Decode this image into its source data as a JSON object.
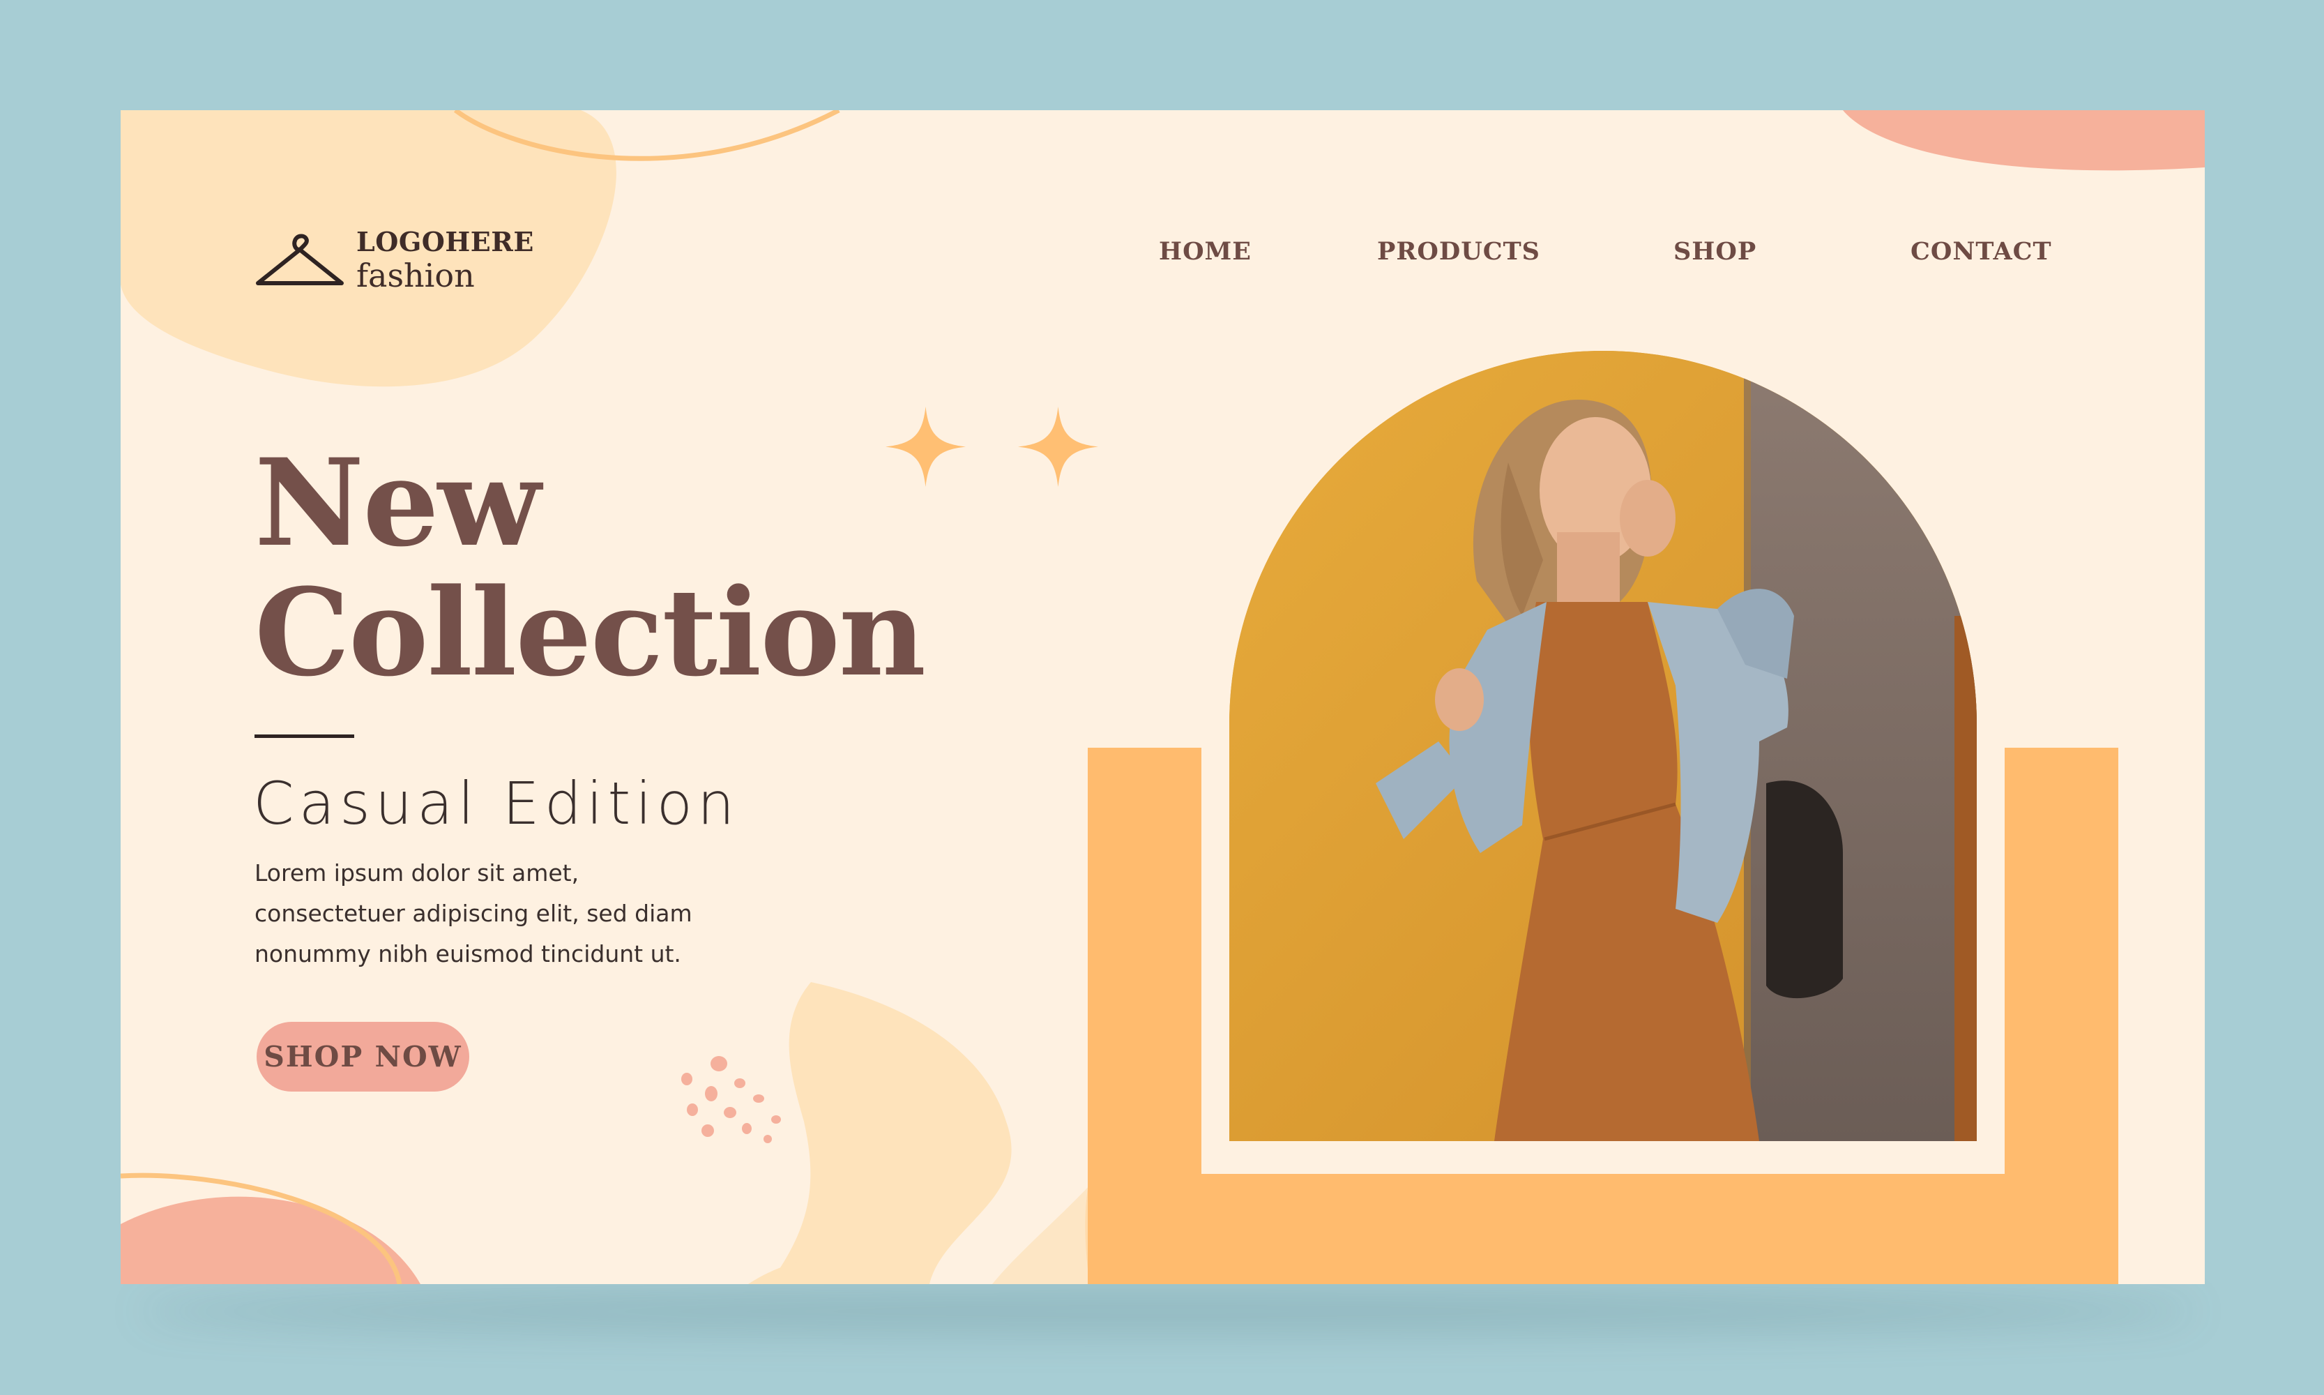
{
  "brand": {
    "logo_top": "LOGOHERE",
    "logo_bottom": "fashion",
    "icon": "hanger-icon"
  },
  "nav": {
    "home": "HOME",
    "products": "PRODUCTS",
    "shop": "SHOP",
    "contact": "CONTACT"
  },
  "hero": {
    "title_line1": "New",
    "title_line2": "Collection",
    "subtitle": "Casual Edition",
    "desc_line1": "Lorem ipsum dolor sit amet,",
    "desc_line2": "consectetuer adipiscing elit, sed diam",
    "desc_line3": "nonummy nibh euismod tincidunt ut.",
    "cta": "SHOP NOW"
  },
  "colors": {
    "background": "#a7cdd4",
    "page": "#fef1e1",
    "title": "#74504a",
    "nav": "#6e4b44",
    "accent_orange": "#ffbb6e",
    "accent_pink": "#f2a99a",
    "sparkle": "#ffbf73"
  }
}
